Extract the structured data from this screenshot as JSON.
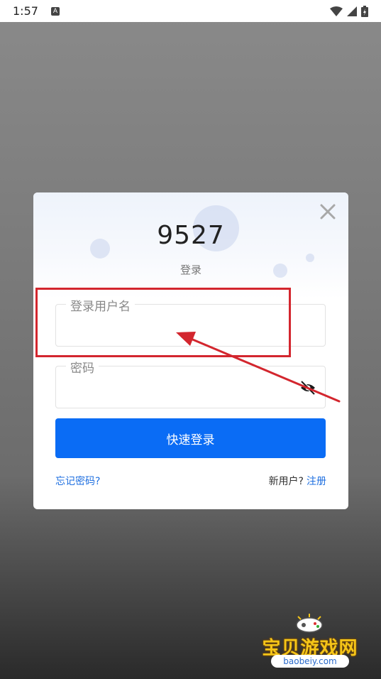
{
  "status_bar": {
    "time": "1:57",
    "notification_icon": "A"
  },
  "dialog": {
    "title": "9527",
    "subtitle": "登录",
    "username_field": {
      "label": "登录用户名",
      "value": ""
    },
    "password_field": {
      "label": "密码",
      "value": ""
    },
    "login_button": "快速登录",
    "forgot_password": "忘记密码?",
    "new_user_prompt": "新用户?",
    "register_link": "注册"
  },
  "watermark": {
    "text": "宝贝游戏网",
    "url": "baobeiy.com"
  },
  "colors": {
    "primary": "#0a6cf5",
    "link": "#1e6fe0",
    "annotation": "#d3262e"
  }
}
